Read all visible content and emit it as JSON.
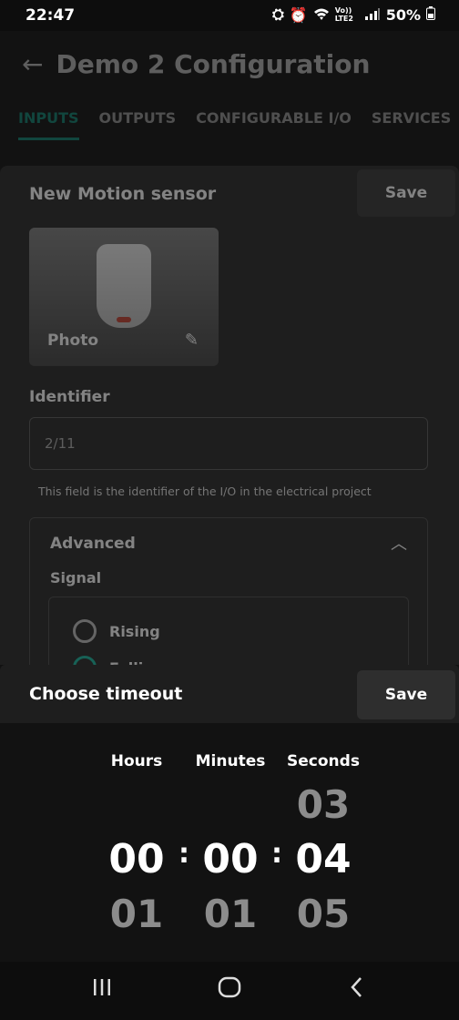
{
  "status": {
    "time": "22:47",
    "network": "Vo)) LTE2",
    "battery": "50%"
  },
  "app": {
    "title": "Demo 2 Configuration",
    "tabs": [
      {
        "label": "INPUTS",
        "active": true
      },
      {
        "label": "OUTPUTS"
      },
      {
        "label": "CONFIGURABLE I/O"
      },
      {
        "label": "SERVICES"
      }
    ],
    "card": {
      "title": "New Motion sensor",
      "save_label": "Save",
      "photo_label": "Photo",
      "identifier_label": "Identifier",
      "identifier_value": "2/11",
      "identifier_helper": "This field is the identifier of the I/O in the electrical project",
      "advanced_label": "Advanced",
      "signal_label": "Signal",
      "signal_options": [
        "Rising",
        "Falling"
      ]
    }
  },
  "sheet": {
    "title": "Choose timeout",
    "save_label": "Save",
    "columns": [
      {
        "header": "Hours",
        "prev": "",
        "selected": "00",
        "next": "01"
      },
      {
        "header": "Minutes",
        "prev": "",
        "selected": "00",
        "next": "01"
      },
      {
        "header": "Seconds",
        "prev": "03",
        "selected": "04",
        "next": "05"
      }
    ],
    "separator": ":"
  },
  "colors": {
    "accent": "#0fb39a"
  }
}
